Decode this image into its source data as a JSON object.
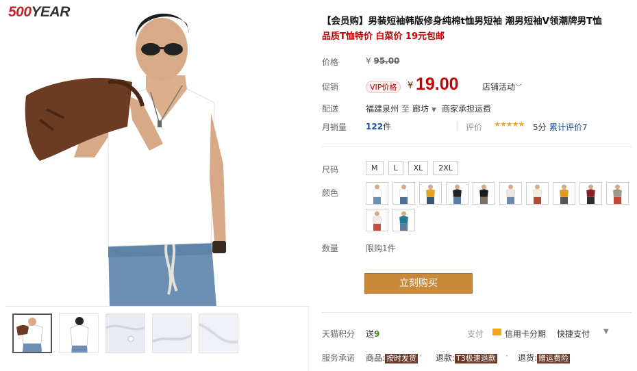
{
  "brand": {
    "logo_prefix": "500",
    "logo_suffix": "YEAR"
  },
  "product": {
    "title": "【会员购】男装短袖韩版修身纯棉t恤男短袖 潮男短袖V领潮牌男T恤",
    "subtitle": "品质T恤特价 白菜价 19元包邮"
  },
  "price": {
    "label": "价格",
    "currency": "¥",
    "original": "95.00",
    "promo_label": "促销",
    "vip_badge": "VIP价格",
    "promo": "19.00",
    "store_activity": "店铺活动"
  },
  "shipping": {
    "label": "配送",
    "from": "福建泉州",
    "to_word": "至",
    "to": "廊坊",
    "note": "商家承担运费"
  },
  "sales": {
    "label": "月销量",
    "count": "122",
    "unit": "件",
    "rating_label": "评价",
    "stars": "★★★★★",
    "score": "5分",
    "reviews": "累计评价7"
  },
  "size": {
    "label": "尺码",
    "options": [
      "M",
      "L",
      "XL",
      "2XL"
    ]
  },
  "color": {
    "label": "颜色",
    "swatches": [
      {
        "shirt": "#ffffff",
        "pants": "#6b8fb5"
      },
      {
        "shirt": "#ffffff",
        "pants": "#4d6f94"
      },
      {
        "shirt": "#e8a020",
        "pants": "#3d5670"
      },
      {
        "shirt": "#222222",
        "pants": "#5b7ea3"
      },
      {
        "shirt": "#1b1b1b",
        "pants": "#7d6f62"
      },
      {
        "shirt": "#e9e6df",
        "pants": "#6e8aa8"
      },
      {
        "shirt": "#f4ede2",
        "pants": "#b34a3c"
      },
      {
        "shirt": "#e39a1e",
        "pants": "#555555"
      },
      {
        "shirt": "#8c1f24",
        "pants": "#2e2e2e"
      },
      {
        "shirt": "#9a9a8a",
        "pants": "#c0473a"
      },
      {
        "shirt": "#f2ece4",
        "pants": "#c94b3c"
      },
      {
        "shirt": "#1f7a94",
        "pants": "#5d7a9a"
      }
    ]
  },
  "quantity": {
    "label": "数量",
    "limit": "限购1件"
  },
  "buy_button": "立刻购买",
  "points": {
    "label": "天猫积分",
    "prefix": "送",
    "value": "9"
  },
  "payment": {
    "label": "支付",
    "card": "信用卡分期",
    "quick": "快捷支付",
    "chevron": "▼"
  },
  "service": {
    "label": "服务承诺",
    "goods_prefix": "商品:",
    "goods_tag": "按时发货",
    "refund_prefix": "退款:",
    "refund_tag": "T3极速退款",
    "return_prefix": "退货:",
    "return_tag": "赠运费险"
  },
  "colors": {
    "price_red": "#c40000",
    "buy_button": "#c98a3b",
    "link_blue": "#1a4ea0",
    "points_green": "#3a8f1f",
    "service_tag": "#6b3b2a"
  }
}
